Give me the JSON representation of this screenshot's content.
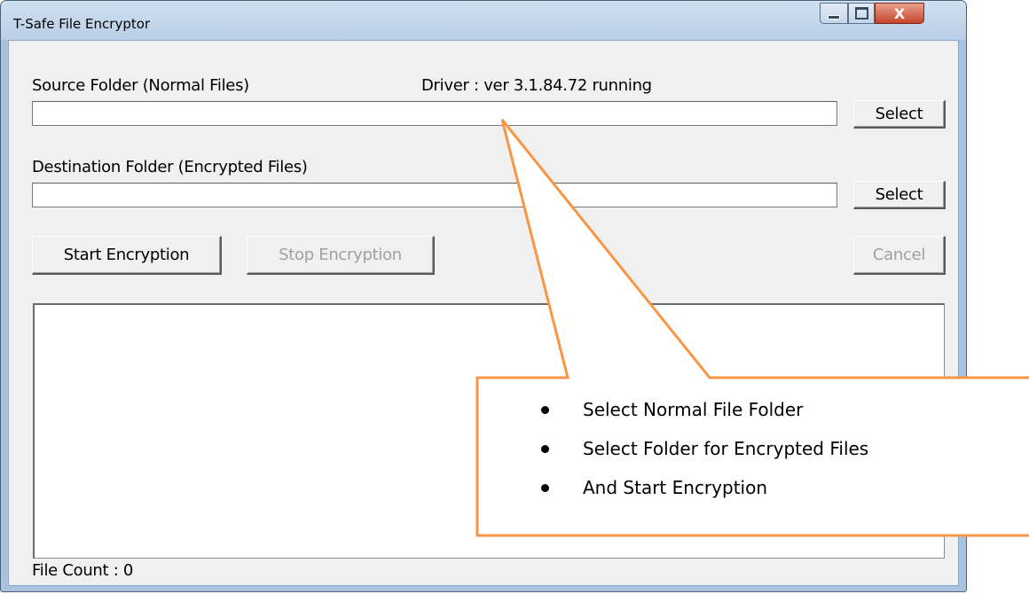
{
  "window": {
    "title": "T-Safe File Encryptor",
    "controls": {
      "minimize": "minimize",
      "maximize": "maximize",
      "close": "X"
    }
  },
  "source": {
    "label": "Source Folder (Normal Files)",
    "value": "",
    "select_label": "Select"
  },
  "driver_status": "Driver : ver 3.1.84.72 running",
  "destination": {
    "label": "Destination Folder (Encrypted Files)",
    "value": "",
    "select_label": "Select"
  },
  "actions": {
    "start_label": "Start Encryption",
    "stop_label": "Stop Encryption",
    "cancel_label": "Cancel"
  },
  "file_count": "File Count : 0",
  "callout": {
    "items": [
      "Select Normal File Folder",
      "Select Folder for Encrypted Files",
      "And Start Encryption"
    ],
    "color": "#f79646"
  },
  "colors": {
    "client_bg": "#f0f0f0",
    "frame": "#a9c3de",
    "close_button": "#c7452c"
  }
}
